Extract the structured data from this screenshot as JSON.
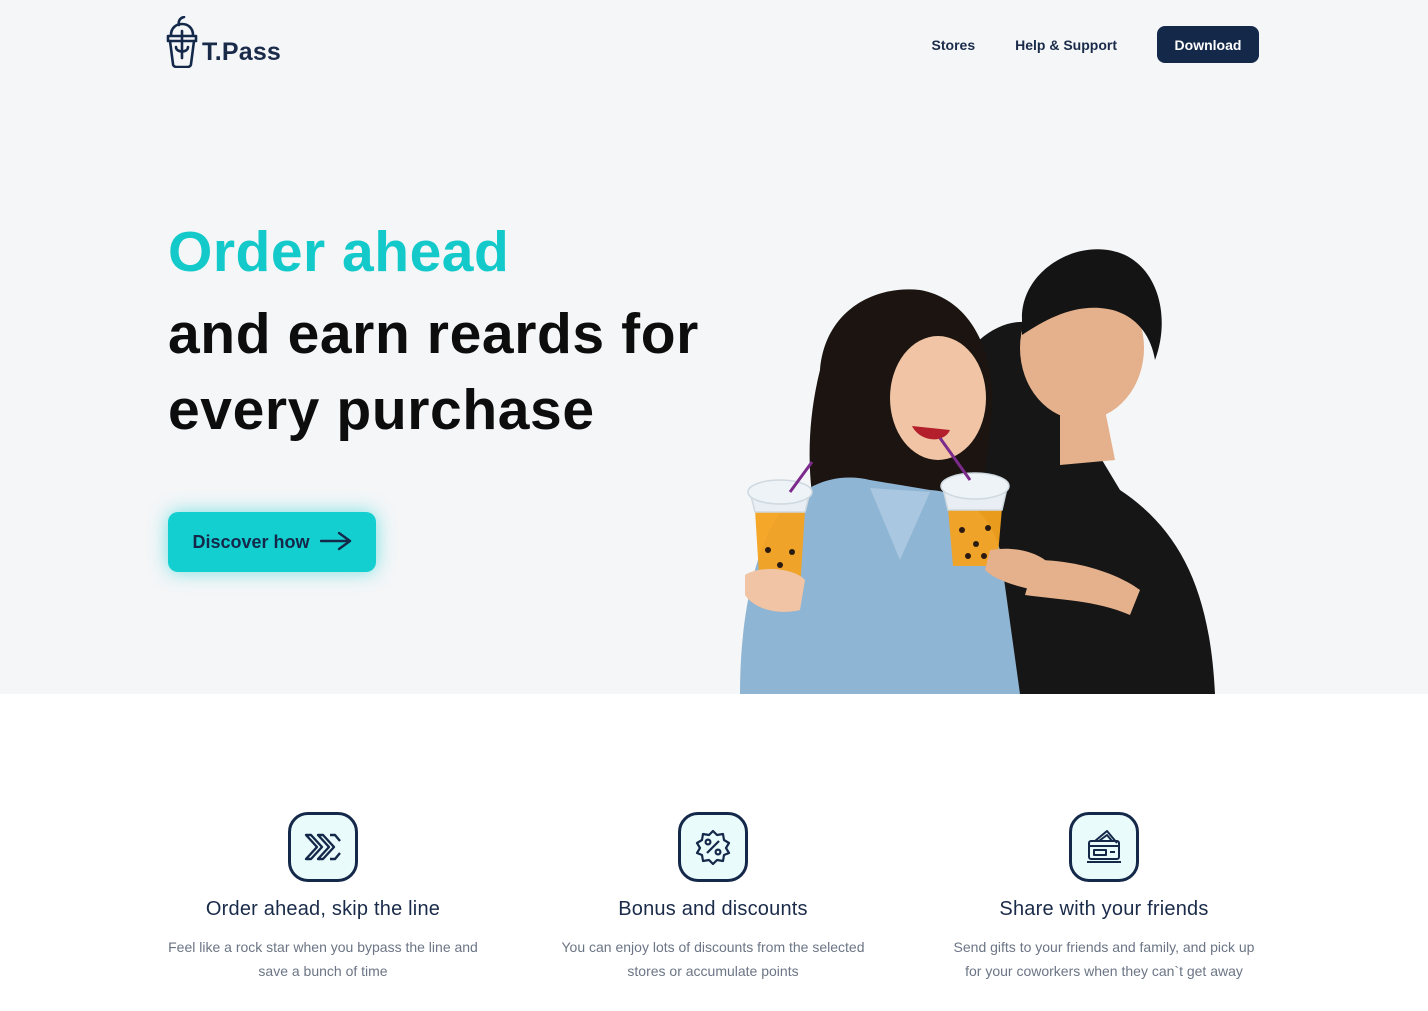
{
  "brand": {
    "name": "T.Pass",
    "logo_icon": "bubble-tea-cup-icon"
  },
  "nav": {
    "links": [
      "Stores",
      "Help & Support"
    ],
    "download_label": "Download"
  },
  "hero": {
    "headline_accent": "Order ahead",
    "headline_line2": "and earn reards for",
    "headline_line3": "every purchase",
    "cta_label": "Discover how",
    "cta_icon": "arrow-right-icon",
    "image": "couple-sharing-bubble-tea-photo"
  },
  "features": [
    {
      "icon": "double-chevron-right-icon",
      "title": "Order ahead, skip the line",
      "text": "Feel like a rock star when you bypass the line and save a bunch of time"
    },
    {
      "icon": "discount-badge-icon",
      "title": "Bonus and discounts",
      "text": "You can enjoy lots of discounts from the selected stores or accumulate points"
    },
    {
      "icon": "gift-cards-icon",
      "title": "Share with your friends",
      "text": "Send gifts to your friends and family, and pick up for your coworkers when they can`t get away"
    }
  ],
  "colors": {
    "accent": "#14cfcf",
    "navy": "#14284a",
    "hero_bg": "#f4f6f8"
  }
}
